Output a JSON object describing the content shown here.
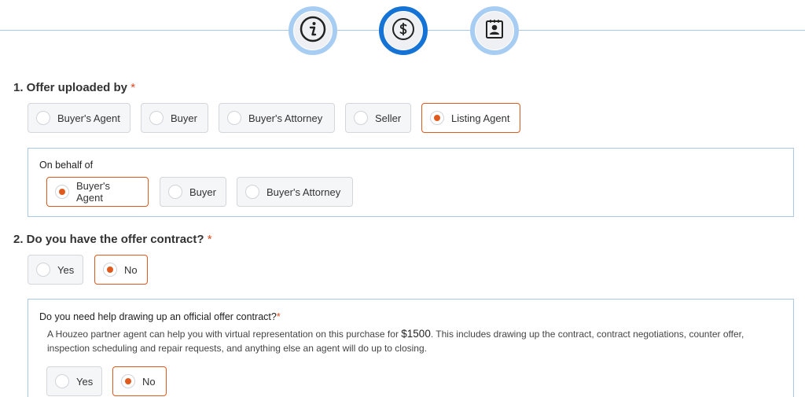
{
  "stepper": {
    "steps": [
      {
        "icon": "info-icon",
        "state": "inactive"
      },
      {
        "icon": "dollar-icon",
        "state": "active"
      },
      {
        "icon": "contact-card-icon",
        "state": "inactive"
      }
    ],
    "colors": {
      "active": "#1573d6",
      "inactive": "#a8cdf3",
      "line": "#a9c7e6"
    }
  },
  "q1": {
    "label": "1. Offer uploaded by",
    "required_mark": "*",
    "options": [
      "Buyer's Agent",
      "Buyer",
      "Buyer's Attorney",
      "Seller",
      "Listing Agent"
    ],
    "selected": "Listing Agent"
  },
  "behalf": {
    "label": "On behalf of",
    "options": [
      "Buyer's Agent",
      "Buyer",
      "Buyer's Attorney"
    ],
    "selected": "Buyer's Agent"
  },
  "q2": {
    "label": "2. Do you have the offer contract?",
    "required_mark": "*",
    "options": [
      "Yes",
      "No"
    ],
    "selected": "No"
  },
  "help": {
    "label": "Do you need help drawing up an official offer contract?",
    "required_mark": "*",
    "description": "A Houzeo partner agent can help you with virtual representation on this purchase for",
    "price": "$1500",
    "description_tail": ". This includes drawing up the contract, contract negotiations, counter offer, inspection scheduling and repair requests, and anything else an agent will do up to closing.",
    "options": [
      "Yes",
      "No"
    ],
    "selected": "No"
  },
  "colors": {
    "accent": "#e05a1e",
    "required": "#e04a1e",
    "panel_border": "#a9c7e6"
  }
}
